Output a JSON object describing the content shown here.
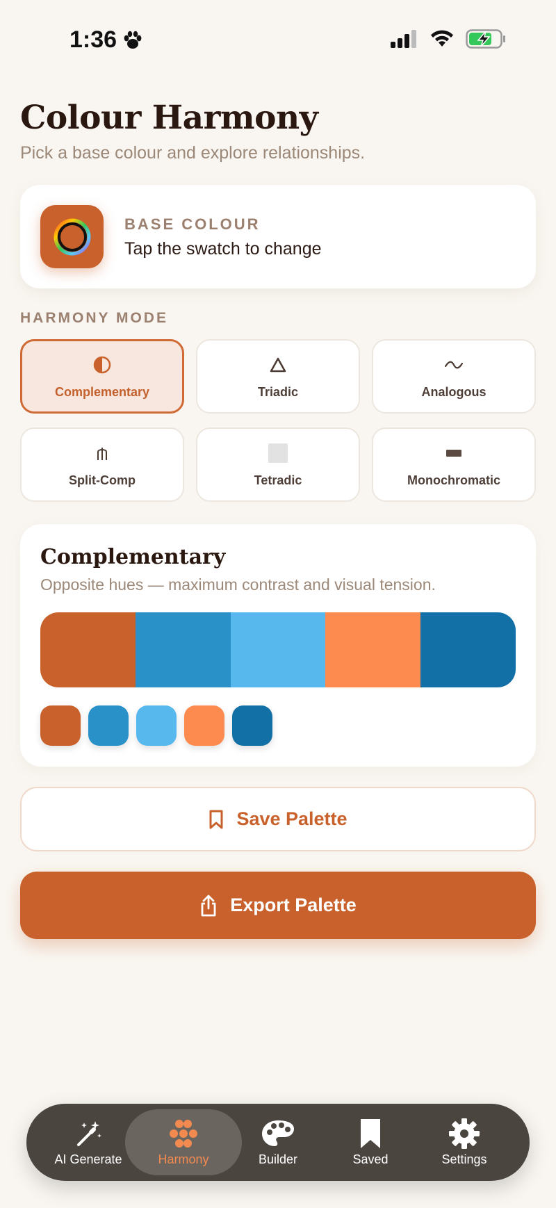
{
  "status_bar": {
    "time": "1:36"
  },
  "header": {
    "title": "Colour Harmony",
    "subtitle": "Pick a base colour and explore relationships."
  },
  "base_colour": {
    "label": "BASE COLOUR",
    "hint": "Tap the swatch to change",
    "color": "#c8612b"
  },
  "harmony_mode": {
    "label": "HARMONY MODE",
    "selected": "Complementary",
    "modes": [
      {
        "label": "Complementary",
        "icon": "half-circle-icon"
      },
      {
        "label": "Triadic",
        "icon": "triangle-icon"
      },
      {
        "label": "Analogous",
        "icon": "tilde-icon"
      },
      {
        "label": "Split-Comp",
        "icon": "pitchfork-icon"
      },
      {
        "label": "Tetradic",
        "icon": "square-icon"
      },
      {
        "label": "Monochromatic",
        "icon": "bar-icon"
      }
    ]
  },
  "result": {
    "title": "Complementary",
    "description": "Opposite hues — maximum contrast and visual tension.",
    "palette": [
      "#c8612b",
      "#2a90c8",
      "#57b8ee",
      "#fd8b4f",
      "#1370a6"
    ]
  },
  "actions": {
    "save_label": "Save Palette",
    "export_label": "Export Palette"
  },
  "tab_bar": {
    "selected": "Harmony",
    "tabs": [
      {
        "label": "AI Generate",
        "icon": "magic-wand-icon"
      },
      {
        "label": "Harmony",
        "icon": "flower-dots-icon"
      },
      {
        "label": "Builder",
        "icon": "palette-icon"
      },
      {
        "label": "Saved",
        "icon": "bookmark-icon"
      },
      {
        "label": "Settings",
        "icon": "gear-icon"
      }
    ]
  },
  "colors": {
    "accent": "#c8612b",
    "accent_light": "#f28a4f",
    "background": "#f9f6f1"
  }
}
